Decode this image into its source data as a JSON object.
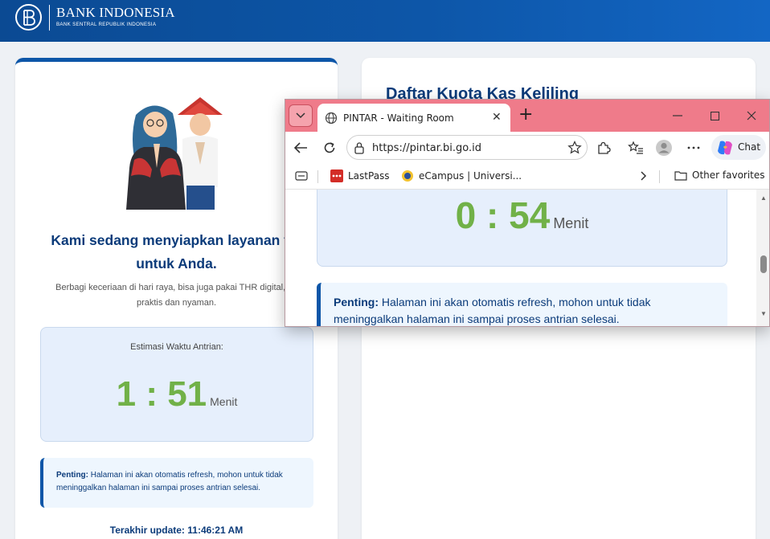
{
  "header": {
    "brand": "BANK INDONESIA",
    "brand_sub": "BANK SENTRAL REPUBLIK INDONESIA"
  },
  "left_card": {
    "heading": "Kami sedang menyiapkan layanan ter\nuntuk Anda.",
    "description": "Berbagi keceriaan di hari raya, bisa juga pakai THR digital, se\npraktis dan nyaman.",
    "queue_label": "Estimasi Waktu Antrian:",
    "queue_time": "1 : 51",
    "queue_unit": "Menit",
    "notice_bold": "Penting:",
    "notice_text": " Halaman ini akan otomatis refresh, mohon untuk tidak meninggalkan halaman ini sampai proses antrian selesai.",
    "last_update": "Terakhir update: 11:46:21 AM"
  },
  "right_card": {
    "title": "Daftar Kuota Kas Keliling"
  },
  "browser": {
    "tab_title": "PINTAR - Waiting Room",
    "url": "https://pintar.bi.go.id",
    "chat_label": "Chat",
    "favorites": [
      {
        "label": "LastPass"
      },
      {
        "label": "eCampus | Universi..."
      }
    ],
    "other_favorites": "Other favorites",
    "page": {
      "queue_time": "0 : 54",
      "queue_unit": "Menit",
      "notice_bold": "Penting:",
      "notice_text": " Halaman ini akan otomatis refresh, mohon untuk tidak meninggalkan halaman ini sampai proses antrian selesai."
    }
  },
  "colors": {
    "brand_blue": "#0d56a8",
    "heading_navy": "#0b3b7a",
    "timer_green": "#71b148",
    "titlebar_pink": "#ef7b8a"
  }
}
